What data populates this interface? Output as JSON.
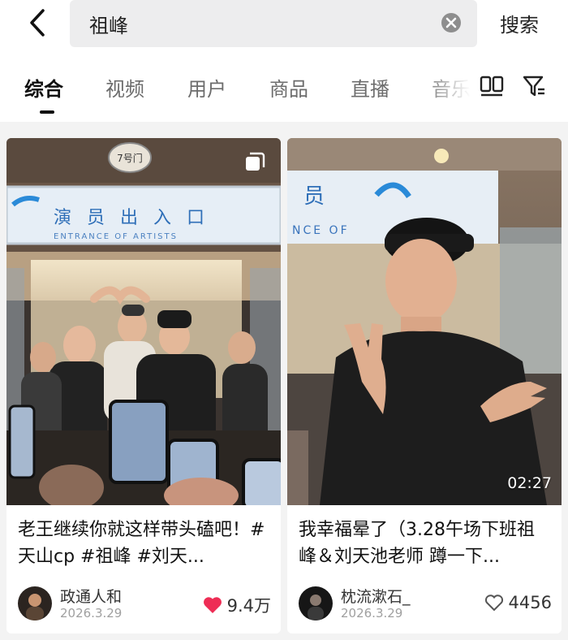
{
  "search": {
    "query": "祖峰",
    "button_label": "搜索"
  },
  "tabs": [
    {
      "label": "综合",
      "active": true
    },
    {
      "label": "视频",
      "active": false
    },
    {
      "label": "用户",
      "active": false
    },
    {
      "label": "商品",
      "active": false
    },
    {
      "label": "直播",
      "active": false
    },
    {
      "label": "音乐",
      "active": false
    }
  ],
  "cards": [
    {
      "caption": "老王继续你就这样带头磕吧！#天山cp #祖峰 #刘天...",
      "author": "政通人和",
      "date": "2026.3.29",
      "likes": "9.4万",
      "liked": true,
      "sign_cn": "演 员 出 入 口",
      "sign_en": "ENTRANCE OF ARTISTS",
      "door_label": "7号门"
    },
    {
      "caption": "我幸福晕了（3.28午场下班祖峰＆刘天池老师 蹲一下...",
      "author": "枕流漱石_",
      "date": "2026.3.29",
      "likes": "4456",
      "liked": false,
      "duration": "02:27",
      "sign_fragment_top": "员",
      "sign_fragment_en": "NCE OF"
    }
  ],
  "colors": {
    "accent_like": "#ee2d55",
    "text_primary": "#111111",
    "text_secondary": "#6c6c6c"
  },
  "icons": [
    "back-arrow-icon",
    "clear-icon",
    "grid-layout-icon",
    "filter-icon",
    "heart-icon",
    "multi-image-icon"
  ]
}
